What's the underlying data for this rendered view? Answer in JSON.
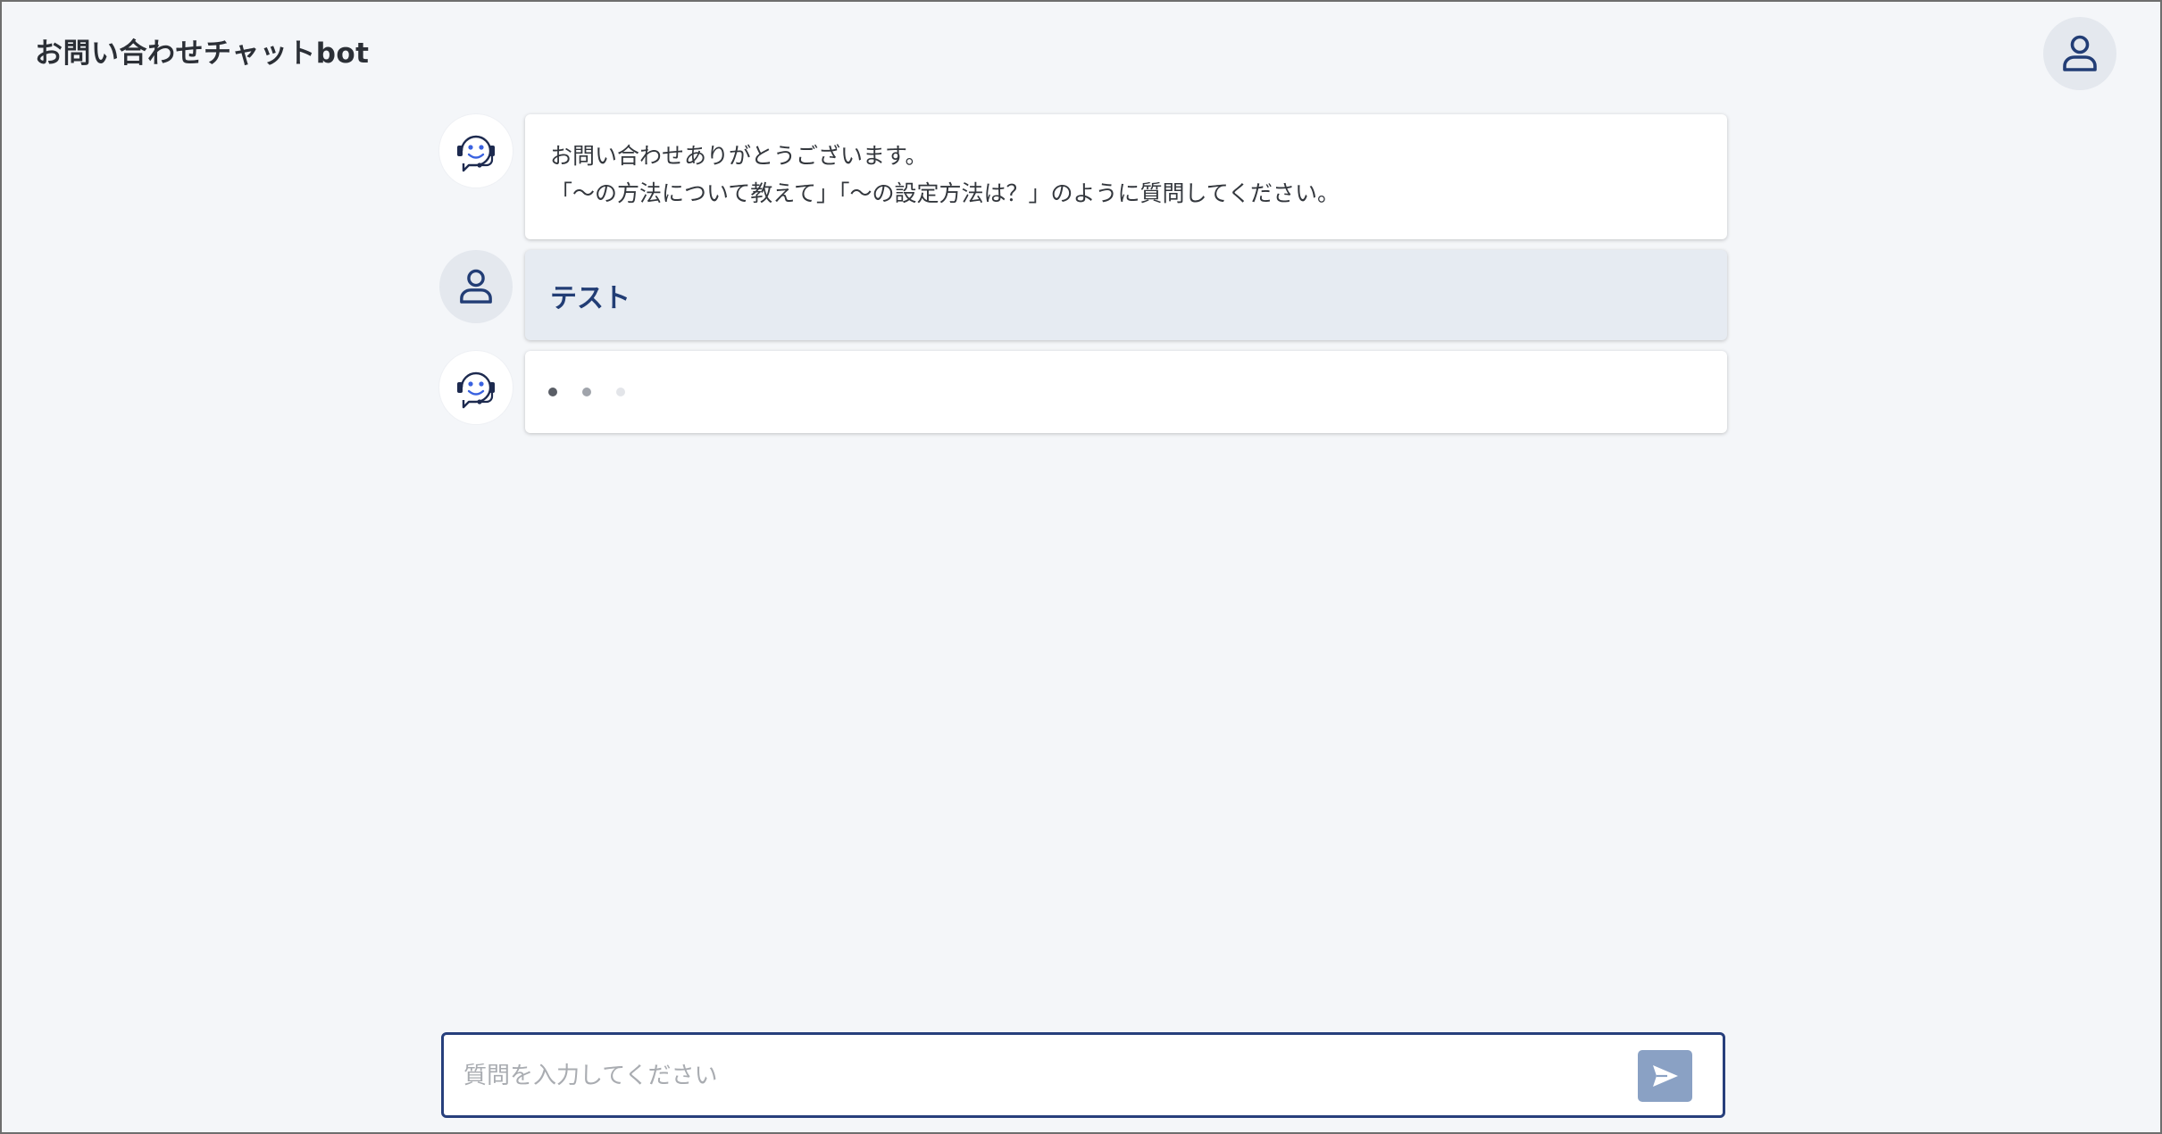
{
  "header": {
    "title": "お問い合わせチャットbot"
  },
  "messages": [
    {
      "role": "bot",
      "lines": [
        "お問い合わせありがとうございます。",
        "「～の方法について教えて」「～の設定方法は？」のように質問してください。"
      ]
    },
    {
      "role": "user",
      "text": "テスト"
    },
    {
      "role": "bot",
      "status": "typing"
    }
  ],
  "composer": {
    "placeholder": "質問を入力してください",
    "value": ""
  },
  "colors": {
    "accent": "#273f7c",
    "user_bubble": "#e6ebf2",
    "send_button": "#8aa1c4",
    "background": "#f4f6f9"
  },
  "icons": {
    "header_avatar": "user-icon",
    "bot_avatar": "support-bot-icon",
    "user_avatar": "user-icon",
    "send": "send-icon"
  }
}
